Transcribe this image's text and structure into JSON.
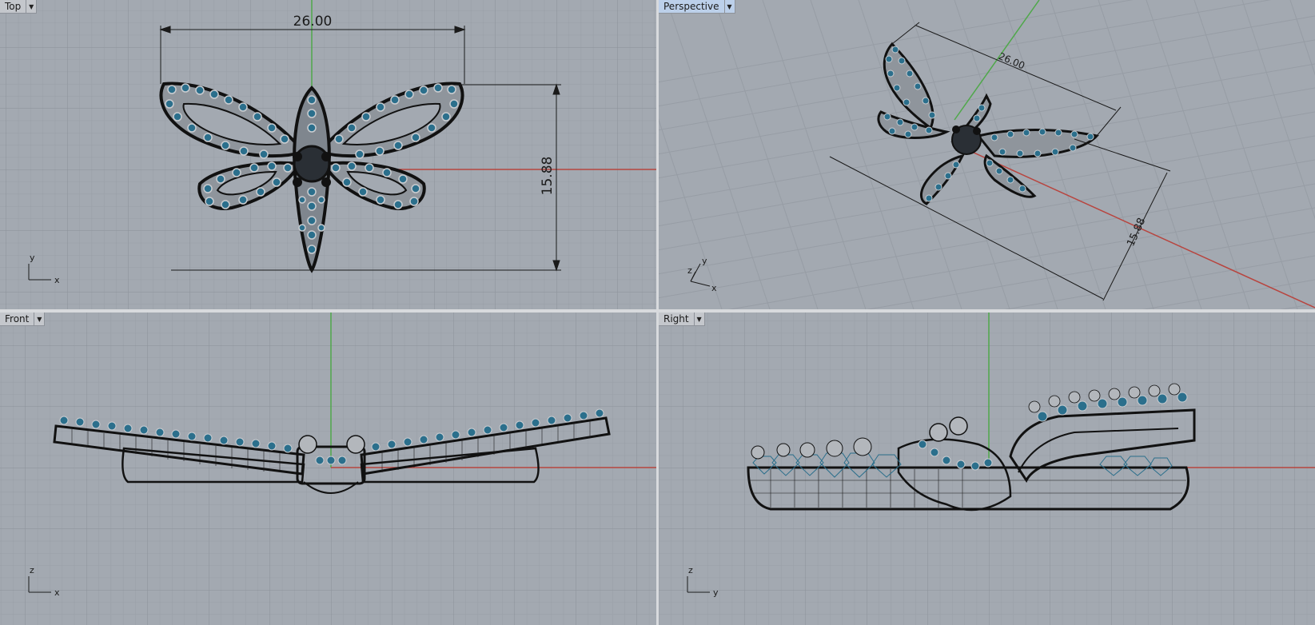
{
  "viewports": {
    "top": {
      "title": "Top",
      "dim_width": "26.00",
      "dim_height": "15.88",
      "axis_a": "y",
      "axis_b": "x"
    },
    "perspective": {
      "title": "Perspective",
      "dim_width": "26.00",
      "dim_height": "15.88",
      "axis_a": "y",
      "axis_b": "x",
      "axis_c": "z"
    },
    "front": {
      "title": "Front",
      "axis_a": "z",
      "axis_b": "x"
    },
    "right": {
      "title": "Right",
      "axis_a": "z",
      "axis_b": "y"
    }
  },
  "icons": {
    "menu": "chevron-down-icon"
  },
  "colors": {
    "viewport_bg": "#a3a9b1",
    "grid_minor": "#989ea6",
    "grid_major": "#8c929a",
    "x_axis": "#b8453f",
    "y_axis": "#4fa84a",
    "gem": "#2b6f8c",
    "prong": "#8a8e93",
    "outline": "#111111"
  }
}
